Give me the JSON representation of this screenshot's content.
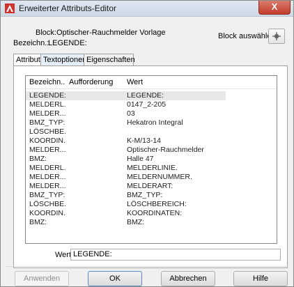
{
  "window": {
    "title": "Erweiterter Attributs-Editor",
    "close_label": "X"
  },
  "header": {
    "block_label": "Block:",
    "block_value": "Optischer-Rauchmelder Vorlage",
    "bezeichn_label": "Bezeichn.:",
    "bezeichn_value": "LEGENDE:",
    "select_block_label": "Block auswählen"
  },
  "tabs": [
    {
      "label": "Attribut"
    },
    {
      "label": "Textoptionen"
    },
    {
      "label": "Eigenschaften"
    }
  ],
  "list": {
    "columns": [
      "Bezeichn...",
      "Aufforderung",
      "Wert"
    ],
    "rows": [
      {
        "tag": "LEGENDE:",
        "prompt": "",
        "value": "LEGENDE:"
      },
      {
        "tag": "MELDERL...",
        "prompt": "",
        "value": "0147_2-205"
      },
      {
        "tag": "MELDER...",
        "prompt": "",
        "value": "03"
      },
      {
        "tag": "BMZ_TYP:",
        "prompt": "",
        "value": "Hekatron Integral"
      },
      {
        "tag": "LÖSCHBE...",
        "prompt": "",
        "value": ""
      },
      {
        "tag": "KOORDIN...",
        "prompt": "",
        "value": "K-M/13-14"
      },
      {
        "tag": "MELDER...",
        "prompt": "",
        "value": "Optischer-Rauchmelder"
      },
      {
        "tag": "BMZ:",
        "prompt": "",
        "value": "Halle 47"
      },
      {
        "tag": "MELDERL...",
        "prompt": "",
        "value": "MELDERLINIE."
      },
      {
        "tag": "MELDER...",
        "prompt": "",
        "value": "MELDERNUMMER."
      },
      {
        "tag": "MELDER...",
        "prompt": "",
        "value": "MELDERART:"
      },
      {
        "tag": "BMZ_TYP:",
        "prompt": "",
        "value": "BMZ_TYP:"
      },
      {
        "tag": "LÖSCHBE...",
        "prompt": "",
        "value": "LÖSCHBEREICH:"
      },
      {
        "tag": "KOORDIN...",
        "prompt": "",
        "value": "KOORDINATEN:"
      },
      {
        "tag": "BMZ:",
        "prompt": "",
        "value": "BMZ:"
      }
    ]
  },
  "value_field": {
    "label": "Wert:",
    "value": "LEGENDE:"
  },
  "buttons": {
    "apply": "Anwenden",
    "ok": "OK",
    "cancel": "Abbrechen",
    "help": "Hilfe"
  },
  "colors": {
    "title_bar": "#cdd8e5",
    "close_button": "#c43c2a",
    "selected_row": "#e8e8e8"
  },
  "icons": {
    "app": "autocad-logo-icon",
    "select_block": "crosshair-icon"
  }
}
